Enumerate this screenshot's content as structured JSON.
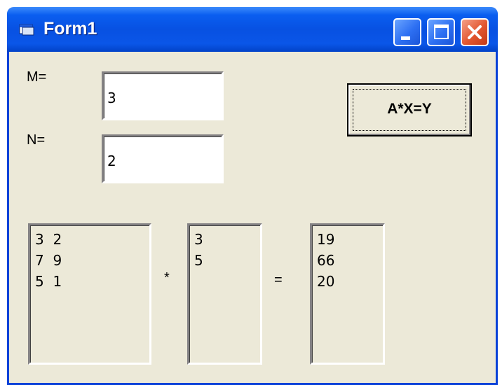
{
  "window": {
    "title": "Form1",
    "title_icon": "form-icon",
    "controls": [
      "minimize-icon",
      "maximize-icon",
      "close-icon"
    ]
  },
  "labels": {
    "m": "M=",
    "n": "N="
  },
  "inputs": {
    "m_value": "3",
    "n_value": "2"
  },
  "button": {
    "label": "A*X=Y"
  },
  "matrix_a": [
    "3  2",
    "7  9",
    "5  1"
  ],
  "vector_x": [
    "3",
    "5"
  ],
  "vector_y": [
    "19",
    "66",
    "20"
  ],
  "operators": {
    "multiply": "*",
    "equals": "="
  },
  "colors": {
    "titlebar": "#0851e2",
    "face": "#ece9d8",
    "close": "#e2562f"
  }
}
